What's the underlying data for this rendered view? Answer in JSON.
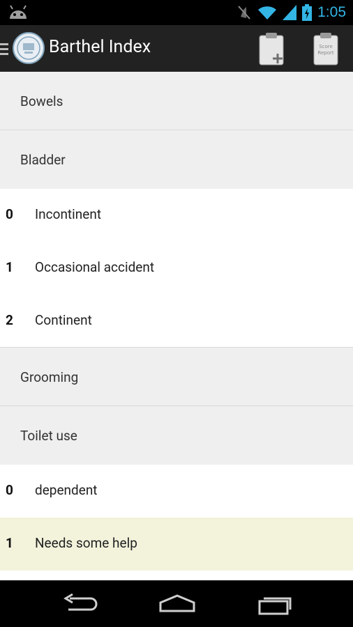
{
  "status_bar": {
    "time": "1:05"
  },
  "action_bar": {
    "title": "Barthel Index",
    "report_icon_text": "Score Report"
  },
  "list": {
    "bowels": {
      "label": "Bowels"
    },
    "bladder": {
      "label": "Bladder",
      "options": [
        {
          "score": "0",
          "text": "Incontinent"
        },
        {
          "score": "1",
          "text": "Occasional accident"
        },
        {
          "score": "2",
          "text": "Continent"
        }
      ]
    },
    "grooming": {
      "label": "Grooming"
    },
    "toilet_use": {
      "label": "Toilet use",
      "options": [
        {
          "score": "0",
          "text": "dependent"
        },
        {
          "score": "1",
          "text": "Needs some help"
        }
      ]
    }
  },
  "colors": {
    "status_accent": "#33b5e5",
    "action_bar_bg": "#222222",
    "group_bg": "#efefef",
    "selected_bg": "#f3f3dc"
  }
}
